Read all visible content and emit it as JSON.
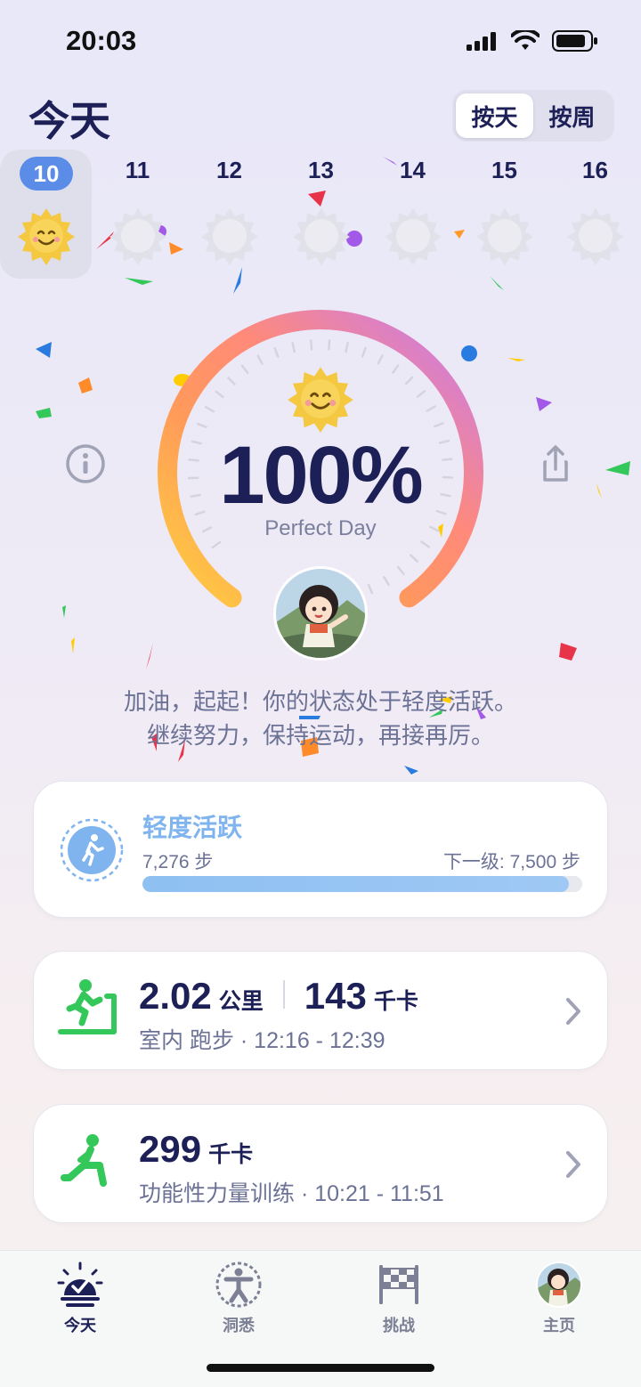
{
  "status_bar": {
    "time": "20:03"
  },
  "header": {
    "title": "今天"
  },
  "segment": {
    "options": [
      "按天",
      "按周"
    ],
    "selected": "按天"
  },
  "days": [
    {
      "num": "10",
      "active": true
    },
    {
      "num": "11",
      "active": false
    },
    {
      "num": "12",
      "active": false
    },
    {
      "num": "13",
      "active": false
    },
    {
      "num": "14",
      "active": false
    },
    {
      "num": "15",
      "active": false
    },
    {
      "num": "16",
      "active": false
    }
  ],
  "ring": {
    "percent": "100%",
    "progress": 1.0,
    "subtitle": "Perfect Day"
  },
  "message": {
    "line1": "加油，起起！你的状态处于轻度活跃。",
    "line2": "继续努力，保持运动，再接再厉。"
  },
  "level_card": {
    "name": "轻度活跃",
    "steps": "7,276 步",
    "next": "下一级: 7,500 步",
    "progress": 0.97
  },
  "workouts": [
    {
      "distance": "2.02",
      "distance_unit": "公里",
      "calories": "143",
      "calories_unit": "千卡",
      "subtitle": "室内 跑步 · 12:16 - 12:39",
      "icon": "treadmill-icon"
    },
    {
      "calories": "299",
      "calories_unit": "千卡",
      "subtitle": "功能性力量训练 · 10:21 - 11:51",
      "icon": "strength-training-icon"
    }
  ],
  "tabbar": {
    "tabs": [
      {
        "label": "今天",
        "icon": "today-icon",
        "active": true
      },
      {
        "label": "洞悉",
        "icon": "insight-icon",
        "active": false
      },
      {
        "label": "挑战",
        "icon": "challenge-flag-icon",
        "active": false
      },
      {
        "label": "主页",
        "icon": "profile-avatar-icon",
        "active": false
      }
    ]
  },
  "colors": {
    "accent": "#5b8de8",
    "text": "#1d2056",
    "workout_green": "#34c759",
    "level_blue": "#7fb4ee"
  }
}
